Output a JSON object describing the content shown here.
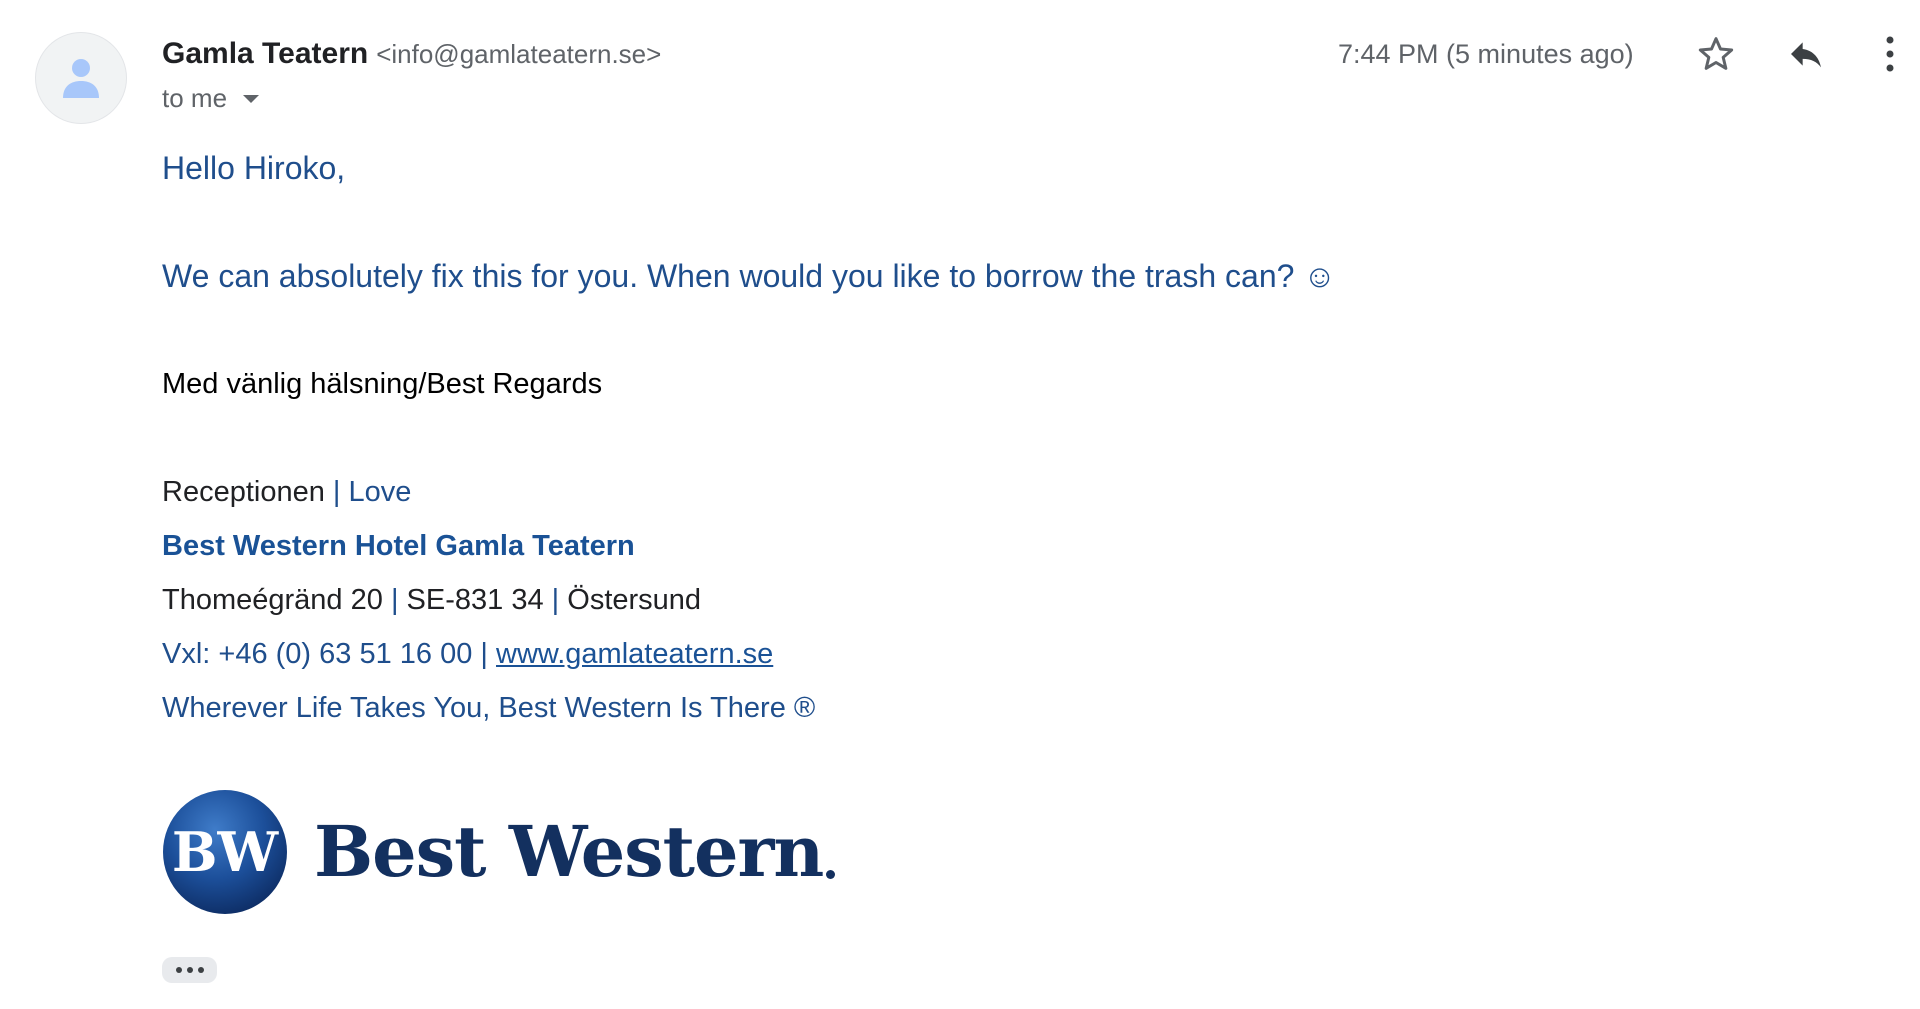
{
  "header": {
    "sender_name": "Gamla Teatern",
    "sender_email": "<info@gamlateatern.se>",
    "recipient": "to me",
    "timestamp": "7:44 PM (5 minutes ago)"
  },
  "icons": {
    "avatar": "person-icon",
    "star": "star-icon",
    "reply": "reply-icon",
    "more": "more-vert-icon",
    "expand": "ellipsis-icon",
    "recipient_dropdown": "caret-down-icon"
  },
  "message": {
    "greeting": "Hello Hiroko,",
    "body": "We can absolutely fix this for you. When would you like to borrow the trash can? ☺"
  },
  "signature": {
    "signoff": "Med vänlig hälsning/Best Regards",
    "department": "Receptionen",
    "department_suffix": "| Love",
    "hotel": "Best Western Hotel Gamla Teatern",
    "address_street": "Thomeégränd 20",
    "address_sep1": "|",
    "address_postal": "SE-831 34",
    "address_sep2": "|",
    "address_city": "Östersund",
    "phone": "Vxl: +46 (0) 63 51 16 00 |",
    "website": "www.gamlateatern.se",
    "slogan": "Wherever Life Takes You, Best Western Is There ®"
  },
  "logo": {
    "badge_text": "BW",
    "wordmark": "Best Western"
  },
  "colors": {
    "link_blue": "#1a5296",
    "body_blue": "#1f4e8c",
    "logo_navy": "#13305f",
    "muted_gray": "#5f6368"
  }
}
